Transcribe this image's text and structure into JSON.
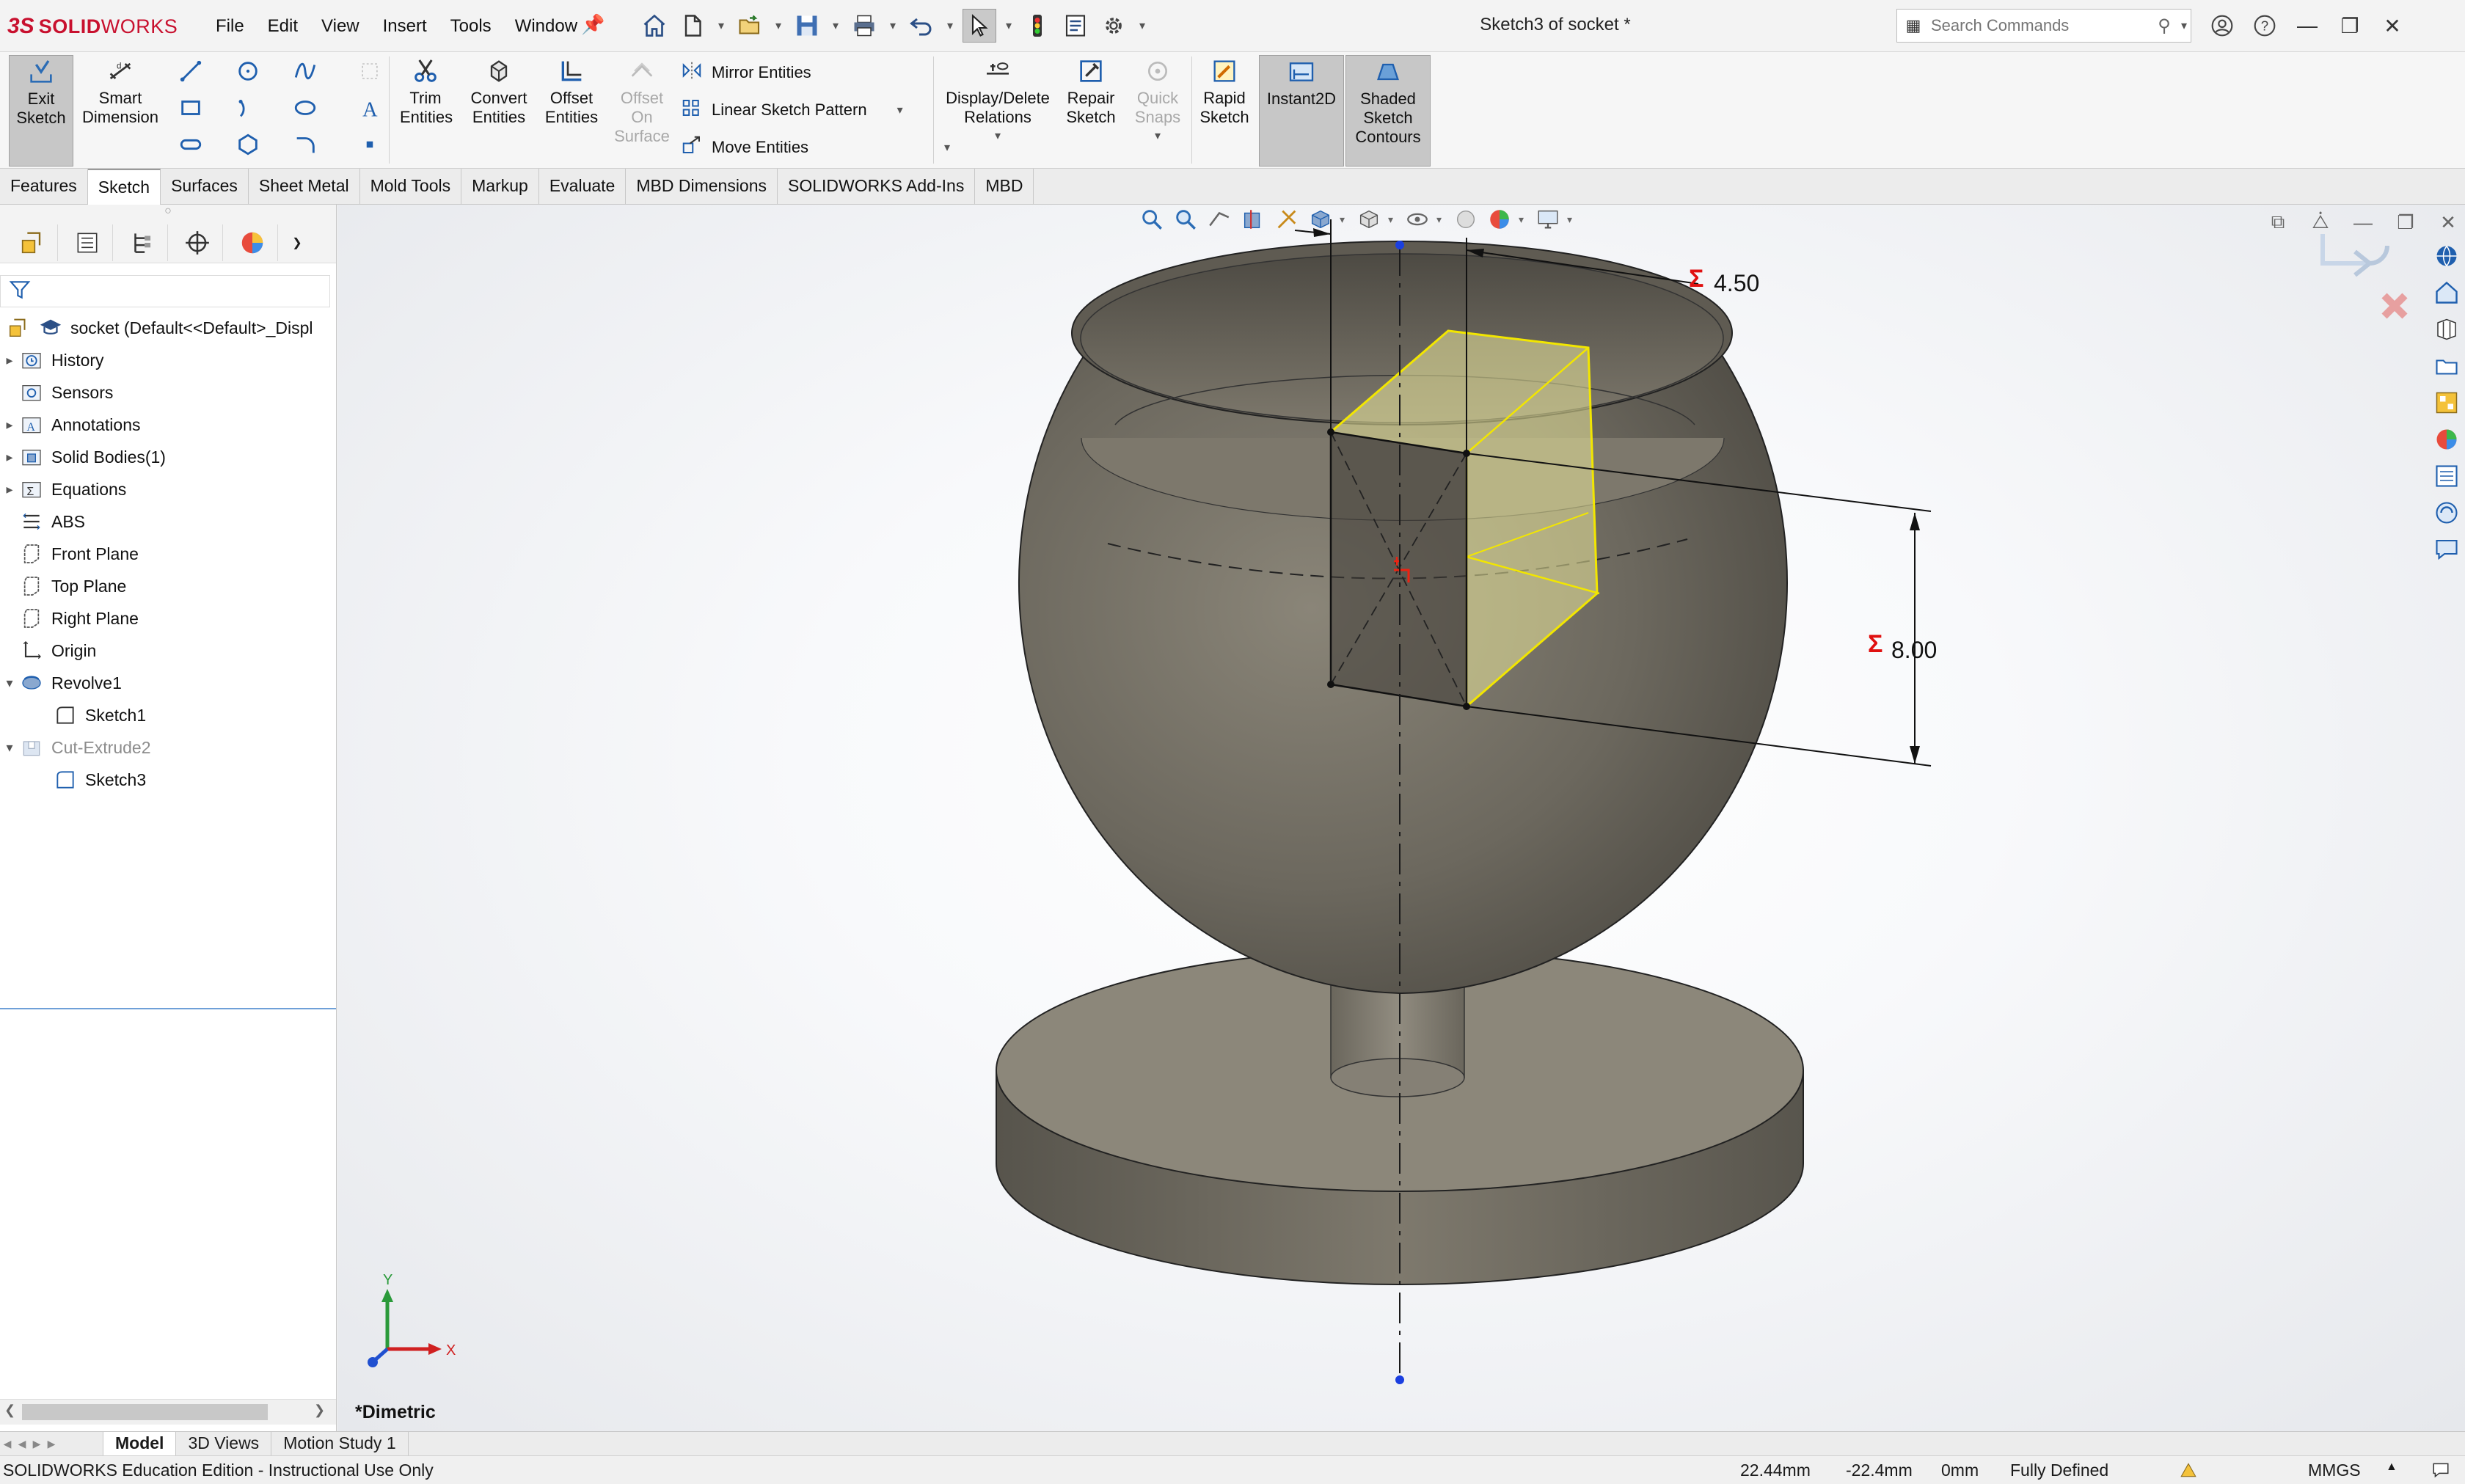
{
  "app": {
    "logo_ds": "3S",
    "logo_solid": "SOLID",
    "logo_works": "WORKS",
    "doc_title": "Sketch3 of socket *"
  },
  "menu": [
    "File",
    "Edit",
    "View",
    "Insert",
    "Tools",
    "Window"
  ],
  "search": {
    "placeholder": "Search Commands"
  },
  "ribbon": {
    "exit_sketch": "Exit Sketch",
    "smart_dimension": "Smart Dimension",
    "trim_entities": "Trim Entities",
    "convert_entities": "Convert Entities",
    "offset_entities": "Offset Entities",
    "offset_on_surface": "Offset On Surface",
    "mirror_entities": "Mirror Entities",
    "linear_sketch_pattern": "Linear Sketch Pattern",
    "move_entities": "Move Entities",
    "display_delete_relations": "Display/Delete Relations",
    "repair_sketch": "Repair Sketch",
    "quick_snaps": "Quick Snaps",
    "rapid_sketch": "Rapid Sketch",
    "instant2d": "Instant2D",
    "shaded_sketch_contours": "Shaded Sketch Contours"
  },
  "tabs": [
    "Features",
    "Sketch",
    "Surfaces",
    "Sheet Metal",
    "Mold Tools",
    "Markup",
    "Evaluate",
    "MBD Dimensions",
    "SOLIDWORKS Add-Ins",
    "MBD"
  ],
  "active_tab": "Sketch",
  "tree": {
    "root": "socket  (Default<<Default>_Displ",
    "items": [
      {
        "label": "History"
      },
      {
        "label": "Sensors"
      },
      {
        "label": "Annotations"
      },
      {
        "label": "Solid Bodies(1)"
      },
      {
        "label": "Equations"
      },
      {
        "label": "ABS"
      },
      {
        "label": "Front Plane"
      },
      {
        "label": "Top Plane"
      },
      {
        "label": "Right Plane"
      },
      {
        "label": "Origin"
      },
      {
        "label": "Revolve1"
      },
      {
        "label": "Sketch1"
      },
      {
        "label": "Cut-Extrude2"
      },
      {
        "label": "Sketch3"
      }
    ]
  },
  "viewport": {
    "dim_width": "4.50",
    "dim_height": "8.00",
    "dim_symbol": "Σ",
    "view_name": "*Dimetric",
    "triad_y": "Y",
    "triad_x": "X"
  },
  "bottom_tabs": [
    "Model",
    "3D Views",
    "Motion Study 1"
  ],
  "active_bottom_tab": "Model",
  "status": {
    "edition": "SOLIDWORKS Education Edition - Instructional Use Only",
    "x": "22.44mm",
    "y": "-22.4mm",
    "z": "0mm",
    "state": "Fully Defined",
    "units": "MMGS"
  }
}
